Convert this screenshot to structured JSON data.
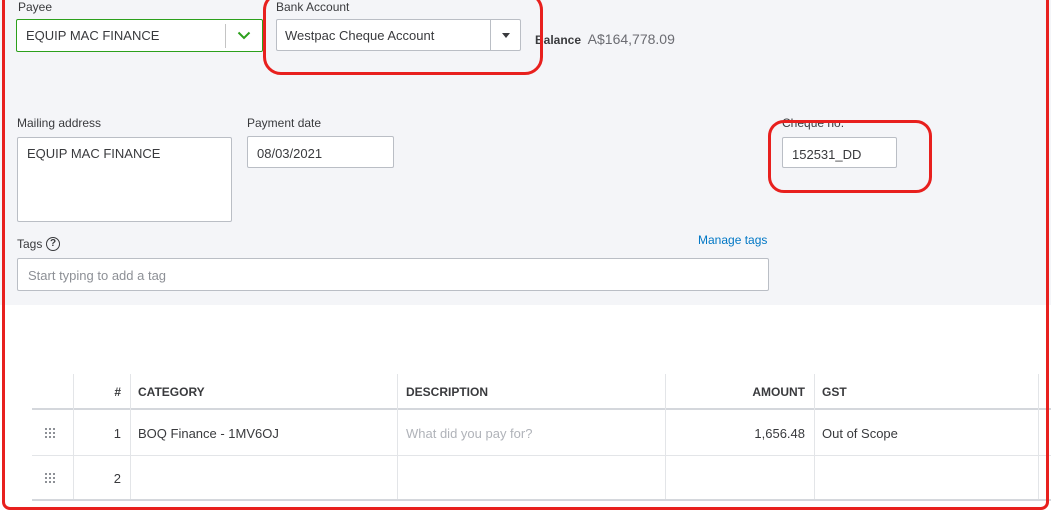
{
  "form": {
    "payee_label": "Payee",
    "payee_value": "EQUIP MAC FINANCE",
    "bank_account_label": "Bank Account",
    "bank_account_value": "Westpac Cheque Account",
    "balance_label": "Balance",
    "balance_value": "A$164,778.09",
    "mailing_address_label": "Mailing address",
    "mailing_address_value": "EQUIP MAC FINANCE",
    "payment_date_label": "Payment date",
    "payment_date_value": "08/03/2021",
    "cheque_no_label": "Cheque no.",
    "cheque_no_value": "152531_DD",
    "tags_label": "Tags",
    "tags_placeholder": "Start typing to add a tag",
    "manage_tags_link": "Manage tags"
  },
  "table": {
    "headers": {
      "num": "#",
      "category": "CATEGORY",
      "description": "DESCRIPTION",
      "amount": "AMOUNT",
      "gst": "GST"
    },
    "rows": [
      {
        "num": "1",
        "category": "BOQ Finance - 1MV6OJ",
        "description_placeholder": "What did you pay for?",
        "amount": "1,656.48",
        "gst": "Out of Scope"
      },
      {
        "num": "2",
        "category": "",
        "description_placeholder": "",
        "amount": "",
        "gst": ""
      }
    ]
  },
  "icons": {
    "payee_dropdown": "chevron-down-icon",
    "bank_dropdown": "caret-down-icon",
    "tags_help": "question-circle-icon",
    "row_drag": "drag-handle-icon"
  },
  "colors": {
    "panel_bg": "#f4f5f8",
    "active_border": "#2ca01c",
    "link": "#0077c5",
    "annotation_red": "#e8201e"
  }
}
